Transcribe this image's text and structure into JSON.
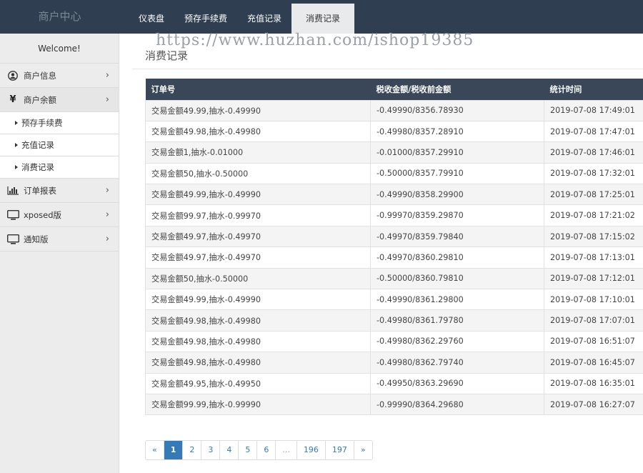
{
  "brand": "商户中心",
  "nav": [
    "仪表盘",
    "预存手续费",
    "充值记录",
    "消费记录"
  ],
  "nav_active": 3,
  "watermark": "https://www.huzhan.com/ishop19385",
  "sidebar": {
    "welcome": "Welcome!",
    "items": [
      {
        "label": "商户信息",
        "icon": "user-circle-icon",
        "arrow": "›"
      },
      {
        "label": "商户余额",
        "icon": "yen-icon",
        "arrow": "›"
      },
      {
        "label": "预存手续费",
        "sub": true
      },
      {
        "label": "充值记录",
        "sub": true
      },
      {
        "label": "消费记录",
        "sub": true
      },
      {
        "label": "订单报表",
        "icon": "bar-chart-icon",
        "arrow": "›"
      },
      {
        "label": "xposed版",
        "icon": "monitor-icon",
        "arrow": "›"
      },
      {
        "label": "通知版",
        "icon": "monitor-icon",
        "arrow": "›"
      }
    ]
  },
  "main": {
    "title": "消费记录",
    "table": {
      "headers": [
        "订单号",
        "税收金额/税收前金额",
        "统计时间"
      ],
      "rows": [
        [
          "交易金额49.99,抽水-0.49990",
          "-0.49990/8356.78930",
          "2019-07-08 17:49:01"
        ],
        [
          "交易金额49.98,抽水-0.49980",
          "-0.49980/8357.28910",
          "2019-07-08 17:47:01"
        ],
        [
          "交易金额1,抽水-0.01000",
          "-0.01000/8357.29910",
          "2019-07-08 17:46:01"
        ],
        [
          "交易金额50,抽水-0.50000",
          "-0.50000/8357.79910",
          "2019-07-08 17:32:01"
        ],
        [
          "交易金额49.99,抽水-0.49990",
          "-0.49990/8358.29900",
          "2019-07-08 17:25:01"
        ],
        [
          "交易金额99.97,抽水-0.99970",
          "-0.99970/8359.29870",
          "2019-07-08 17:21:02"
        ],
        [
          "交易金额49.97,抽水-0.49970",
          "-0.49970/8359.79840",
          "2019-07-08 17:15:02"
        ],
        [
          "交易金额49.97,抽水-0.49970",
          "-0.49970/8360.29810",
          "2019-07-08 17:13:01"
        ],
        [
          "交易金额50,抽水-0.50000",
          "-0.50000/8360.79810",
          "2019-07-08 17:12:01"
        ],
        [
          "交易金额49.99,抽水-0.49990",
          "-0.49990/8361.29800",
          "2019-07-08 17:10:01"
        ],
        [
          "交易金额49.98,抽水-0.49980",
          "-0.49980/8361.79780",
          "2019-07-08 17:07:01"
        ],
        [
          "交易金额49.98,抽水-0.49980",
          "-0.49980/8362.29760",
          "2019-07-08 16:51:07"
        ],
        [
          "交易金额49.98,抽水-0.49980",
          "-0.49980/8362.79740",
          "2019-07-08 16:45:07"
        ],
        [
          "交易金额49.95,抽水-0.49950",
          "-0.49950/8363.29690",
          "2019-07-08 16:35:01"
        ],
        [
          "交易金额99.99,抽水-0.99990",
          "-0.99990/8364.29680",
          "2019-07-08 16:27:07"
        ]
      ]
    },
    "pagination": [
      "«",
      "1",
      "2",
      "3",
      "4",
      "5",
      "6",
      "...",
      "196",
      "197",
      "»"
    ],
    "pagination_active": 1
  },
  "colors": {
    "topbar": "#2f3e50",
    "table_header": "#3a4759",
    "accent": "#337ab7"
  }
}
